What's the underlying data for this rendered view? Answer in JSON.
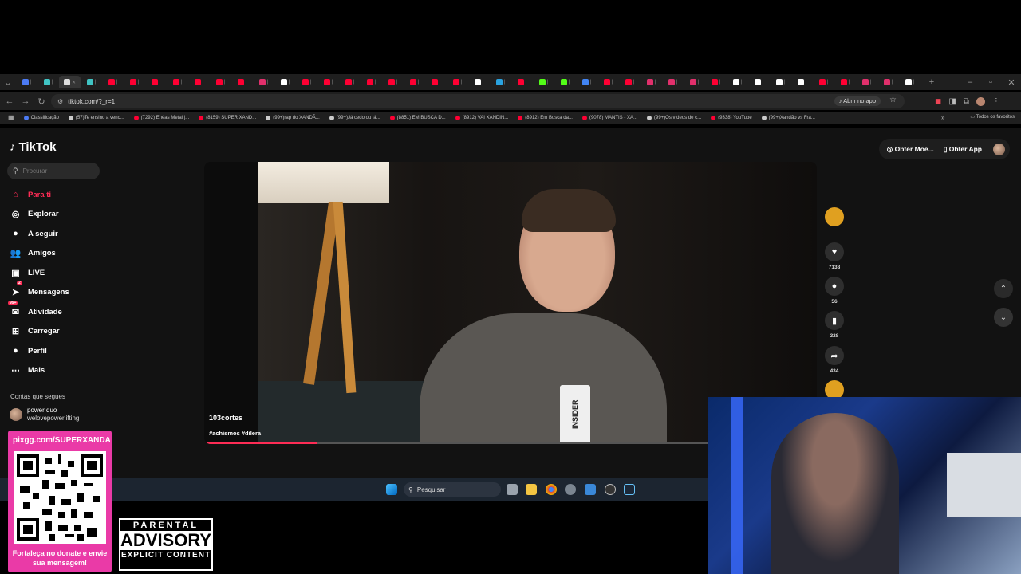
{
  "browser": {
    "url": "tiktok.com/?_r=1",
    "open_in_app": "Abrir no app",
    "bookmarks": [
      {
        "label": "Classificação",
        "color": "#4c7bf4"
      },
      {
        "label": "(57)Te ensino a venc...",
        "color": "#cccccc"
      },
      {
        "label": "(7292) Enéas Metal |...",
        "color": "#ff0033"
      },
      {
        "label": "(8159) SUPER XAND...",
        "color": "#ff0033"
      },
      {
        "label": "(99+)rap do XANDÃ...",
        "color": "#cccccc"
      },
      {
        "label": "(99+)Já cedo ou já...",
        "color": "#cccccc"
      },
      {
        "label": "(8851) EM BUSCA D...",
        "color": "#ff0033"
      },
      {
        "label": "(8912) VAI XANDIN...",
        "color": "#ff0033"
      },
      {
        "label": "(8912) Em Busca da...",
        "color": "#ff0033"
      },
      {
        "label": "(9078) MANTIS - XA...",
        "color": "#ff0033"
      },
      {
        "label": "(99+)Os vídeos de c...",
        "color": "#cccccc"
      },
      {
        "label": "(9338) YouTube",
        "color": "#ff0033"
      },
      {
        "label": "(99+)Xandão vs Fra...",
        "color": "#cccccc"
      }
    ],
    "all_bookmarks": "Todos os favoritos",
    "tab_colors": [
      "#4c7bf4",
      "#40c4c4",
      "#dddddd",
      "#40c4c4",
      "#ff0033",
      "#ff0033",
      "#ff0033",
      "#ff0033",
      "#ff0033",
      "#ff0033",
      "#ff0033",
      "#e1306c",
      "#ffffff",
      "#ff0033",
      "#ff0033",
      "#ff0033",
      "#ff0033",
      "#ff0033",
      "#ff0033",
      "#ff0033",
      "#ff0033",
      "#ffffff",
      "#2aa3e0",
      "#ff0033",
      "#53fc18",
      "#53fc18",
      "#4285f4",
      "#ff0033",
      "#ff0033",
      "#e1306c",
      "#e1306c",
      "#e1306c",
      "#ff0033",
      "#ffffff",
      "#ffffff",
      "#ffffff",
      "#ffffff",
      "#ff0033",
      "#ff0033",
      "#e1306c",
      "#e1306c",
      "#ffffff"
    ]
  },
  "tiktok": {
    "logo": "TikTok",
    "search_placeholder": "Procurar",
    "nav": [
      {
        "label": "Para ti",
        "icon": "home-icon",
        "glyph": "⌂"
      },
      {
        "label": "Explorar",
        "icon": "compass-icon",
        "glyph": "◎"
      },
      {
        "label": "A seguir",
        "icon": "following-icon",
        "glyph": "●"
      },
      {
        "label": "Amigos",
        "icon": "friends-icon",
        "glyph": "👥"
      },
      {
        "label": "LIVE",
        "icon": "live-icon",
        "glyph": "▣"
      },
      {
        "label": "Mensagens",
        "icon": "messages-icon",
        "glyph": "➤",
        "badge": "2"
      },
      {
        "label": "Atividade",
        "icon": "activity-icon",
        "glyph": "✉",
        "badge": "99+"
      },
      {
        "label": "Carregar",
        "icon": "upload-icon",
        "glyph": "⊞"
      },
      {
        "label": "Perfil",
        "icon": "profile-icon",
        "glyph": "●"
      },
      {
        "label": "Mais",
        "icon": "more-icon",
        "glyph": "⋯"
      }
    ],
    "following_title": "Contas que segues",
    "following": {
      "name": "power duo",
      "handle": "welovepowerlifting"
    },
    "get_coins": "Obter Moe...",
    "get_app": "Obter App",
    "video": {
      "author": "103cortes",
      "tags": "#achismos #dilera",
      "badge_text": "INSIDER",
      "progress": 0.18
    },
    "actions": {
      "likes": "7138",
      "comments": "56",
      "saves": "328",
      "shares": "434"
    }
  },
  "taskbar": {
    "search_label": "Pesquisar"
  },
  "overlay": {
    "donate_url": "pixgg.com/SUPERXANDA",
    "donate_message": "Fortaleça no donate e envie sua mensagem!",
    "advisory_top": "PARENTAL",
    "advisory_mid": "ADVISORY",
    "advisory_bottom": "EXPLICIT CONTENT"
  }
}
